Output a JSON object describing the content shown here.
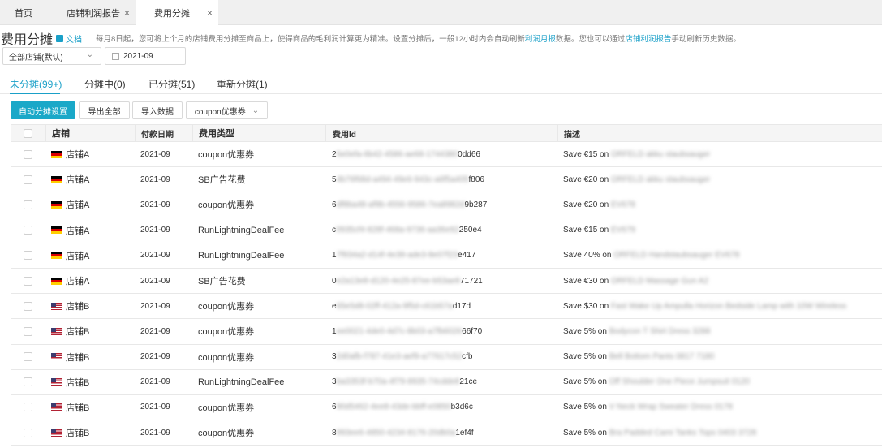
{
  "tabs": [
    {
      "label": "首页",
      "closable": false
    },
    {
      "label": "店铺利润报告",
      "closable": true
    },
    {
      "label": "费用分摊",
      "closable": true,
      "active": true
    }
  ],
  "close_glyph": "×",
  "header": {
    "title": "费用分摊",
    "doc_label": "文档",
    "desc_part1": "每月8日起，您可将上个月的店铺费用分摊至商品上，使得商品的毛利润计算更为精准。设置分摊后，一般12小时内会自动刷新",
    "desc_link1": "利润月报",
    "desc_part2": "数据。您也可以通过",
    "desc_link2": "店铺利润报告",
    "desc_part3": "手动刷新历史数据。"
  },
  "filters": {
    "store_select": "全部店铺(默认)",
    "date": "2021-09"
  },
  "subtabs": [
    {
      "label": "未分摊(99+)",
      "active": true
    },
    {
      "label": "分摊中(0)"
    },
    {
      "label": "已分摊(51)"
    },
    {
      "label": "重新分摊(1)"
    }
  ],
  "actions": {
    "auto_button": "自动分摊设置",
    "export_button": "导出全部",
    "import_button": "导入数据",
    "type_filter": "coupon优惠券"
  },
  "table": {
    "columns": [
      "店铺",
      "付款日期",
      "费用类型",
      "费用Id",
      "描述"
    ],
    "rows": [
      {
        "flag": "de",
        "store": "店铺A",
        "date": "2021-09",
        "type": "coupon优惠券",
        "id_pre": "2",
        "id_mid": "5e0efa-6b42-4586-ae68-1744380",
        "id_post": "0dd66",
        "desc_pre": "Save €15 on",
        "desc_blur": "ORFELD akku staubsauger"
      },
      {
        "flag": "de",
        "store": "店铺A",
        "date": "2021-09",
        "type": "SB广告花费",
        "id_pre": "5",
        "id_mid": "4b76f68d-a494-49e6-943c-a6f5a405",
        "id_post": "f806",
        "desc_pre": "Save €20 on",
        "desc_blur": "ORFELD akku staubsauger"
      },
      {
        "flag": "de",
        "store": "店铺A",
        "date": "2021-09",
        "type": "coupon优惠券",
        "id_pre": "6",
        "id_mid": "df8ba48-af9b-4556-9586-7ea8982d",
        "id_post": "9b287",
        "desc_pre": "Save €20 on",
        "desc_blur": "EV678"
      },
      {
        "flag": "de",
        "store": "店铺A",
        "date": "2021-09",
        "type": "RunLightningDealFee",
        "id_pre": "c",
        "id_mid": "0935cf4-828f-468a-9736-aa36e92",
        "id_post": "250e4",
        "desc_pre": "Save €15 on",
        "desc_blur": "EV679"
      },
      {
        "flag": "de",
        "store": "店铺A",
        "date": "2021-09",
        "type": "RunLightningDealFee",
        "id_pre": "1",
        "id_mid": "7f934a2-d14f-4e39-ade3-8e07f23",
        "id_post": "e417",
        "desc_pre": "Save 40% on",
        "desc_blur": "ORFELD Handstaubsauger EV678"
      },
      {
        "flag": "de",
        "store": "店铺A",
        "date": "2021-09",
        "type": "SB广告花费",
        "id_pre": "0",
        "id_mid": "e2a13e8-d120-4e25-87ee-b53ae8",
        "id_post": "71721",
        "desc_pre": "Save €30 on",
        "desc_blur": "ORFELD Massage Gun A2"
      },
      {
        "flag": "us",
        "store": "店铺B",
        "date": "2021-09",
        "type": "coupon优惠券",
        "id_pre": "e",
        "id_mid": "65e5d8-02ff-412a-9f5d-c61b57a",
        "id_post": "d17d",
        "desc_pre": "Save $30 on",
        "desc_blur": "Fast Wake Up Ampulla Horizon Bedside Lamp with 10W Wireless"
      },
      {
        "flag": "us",
        "store": "店铺B",
        "date": "2021-09",
        "type": "coupon优惠券",
        "id_pre": "1",
        "id_mid": "ee0021-4de0-4d7c-8b03-a7fb6026",
        "id_post": "66f70",
        "desc_pre": "Save 5% on",
        "desc_blur": "Bodycon T Shirt Dress 3288"
      },
      {
        "flag": "us",
        "store": "店铺B",
        "date": "2021-09",
        "type": "coupon优惠券",
        "id_pre": "3",
        "id_mid": "2d0afb-f787-41e3-aef9-a77617c52",
        "id_post": "cfb",
        "desc_pre": "Save 5% on",
        "desc_blur": "Bell Bottom Pants 0817 7180"
      },
      {
        "flag": "us",
        "store": "店铺B",
        "date": "2021-09",
        "type": "RunLightningDealFee",
        "id_pre": "3",
        "id_mid": "ba3353f-b70a-4f79-8935-74cdde8",
        "id_post": "21ce",
        "desc_pre": "Save 5% on",
        "desc_blur": "Off Shoulder One Piece Jumpsuit 0120"
      },
      {
        "flag": "us",
        "store": "店铺B",
        "date": "2021-09",
        "type": "coupon优惠券",
        "id_pre": "6",
        "id_mid": "90d5462-4ee8-43de-bbff-e0850",
        "id_post": "b3d6c",
        "desc_pre": "Save 5% on",
        "desc_blur": "V Neck Wrap Sweater Dress 0178"
      },
      {
        "flag": "us",
        "store": "店铺B",
        "date": "2021-09",
        "type": "coupon优惠券",
        "id_pre": "8",
        "id_mid": "993ee6-4850-4234-8176-20db0a",
        "id_post": "1ef4f",
        "desc_pre": "Save 5% on",
        "desc_blur": "Bra Padded Cami Tanks Tops 0403 3728"
      }
    ]
  }
}
